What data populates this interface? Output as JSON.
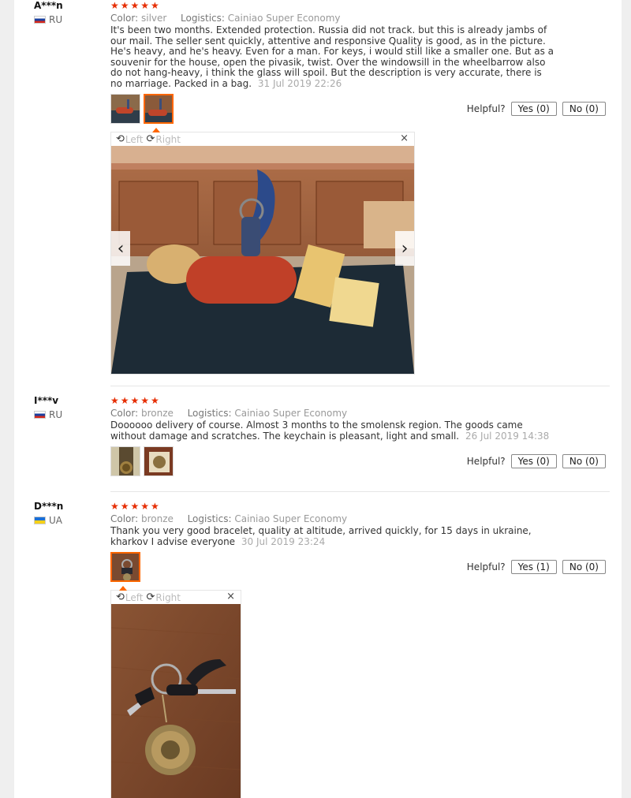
{
  "reviews": [
    {
      "name": "A***n",
      "country": "RU",
      "stars": "★★★★★",
      "color_label": "Color:",
      "color_value": "silver",
      "logistics_label": "Logistics:",
      "logistics_value": "Cainiao Super Economy",
      "text": "It's been two months. Extended protection. Russia did not track. but this is already jambs of our mail. The seller sent quickly, attentive and responsive Quality is good, as in the picture. He's heavy, and he's heavy. Even for a man. For keys, i would still like a smaller one. But as a souvenir for the house, open the pivasik, twist. Over the windowsill in the wheelbarrow also do not hang-heavy, i think the glass will spoil. But the description is very accurate, there is no marriage. Packed in a bag.",
      "date": "31 Jul 2019 22:26",
      "helpful_label": "Helpful?",
      "yes_label": "Yes (0)",
      "no_label": "No (0)"
    },
    {
      "name": "I***v",
      "country": "RU",
      "stars": "★★★★★",
      "color_label": "Color:",
      "color_value": "bronze",
      "logistics_label": "Logistics:",
      "logistics_value": "Cainiao Super Economy",
      "text": "Doooooo delivery of course. Almost 3 months to the smolensk region. The goods came without damage and scratches. The keychain is pleasant, light and small.",
      "date": "26 Jul 2019 14:38",
      "helpful_label": "Helpful?",
      "yes_label": "Yes (0)",
      "no_label": "No (0)"
    },
    {
      "name": "D***n",
      "country": "UA",
      "stars": "★★★★★",
      "color_label": "Color:",
      "color_value": "bronze",
      "logistics_label": "Logistics:",
      "logistics_value": "Cainiao Super Economy",
      "text": "Thank you very good bracelet, quality at altitude, arrived quickly, for 15 days in ukraine, kharkov I advise everyone",
      "date": "30 Jul 2019 23:24",
      "helpful_label": "Helpful?",
      "yes_label": "Yes (1)",
      "no_label": "No (0)"
    }
  ],
  "viewer": {
    "left_label": "Left",
    "right_label": "Right",
    "close_glyph": "×",
    "prev_glyph": "‹",
    "next_glyph": "›",
    "rotate_left_glyph": "⟲",
    "rotate_right_glyph": "⟳"
  }
}
